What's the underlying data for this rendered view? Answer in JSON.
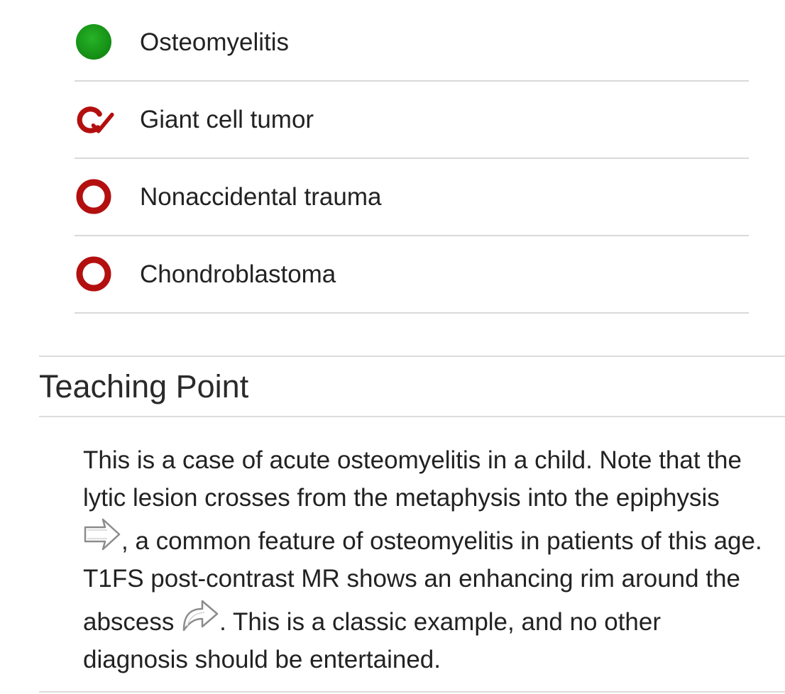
{
  "answer_options": [
    {
      "label": "Osteomyelitis",
      "status": "correct",
      "icon": "filled-green-circle-icon"
    },
    {
      "label": "Giant cell tumor",
      "status": "selected-incorrect",
      "icon": "red-ring-check-icon"
    },
    {
      "label": "Nonaccidental trauma",
      "status": "incorrect",
      "icon": "red-ring-icon"
    },
    {
      "label": "Chondroblastoma",
      "status": "incorrect",
      "icon": "red-ring-icon"
    }
  ],
  "teaching_point": {
    "title": "Teaching Point",
    "text_part1": "This is a case of acute osteomyelitis in a child. Note that the lytic lesion crosses from the metaphysis into the epiphysis",
    "arrow1_icon": "straight-arrow-icon",
    "text_part2": ", a common feature of osteomyelitis in patients of this age. T1FS post-contrast MR shows an enhancing rim around the abscess",
    "arrow2_icon": "curved-arrow-icon",
    "text_part3": ". This is a classic example, and no other diagnosis should be entertained."
  },
  "colors": {
    "correct_green": "#1a9a1a",
    "incorrect_red": "#b30f0f",
    "divider": "#d9d9d9",
    "text": "#222222"
  }
}
